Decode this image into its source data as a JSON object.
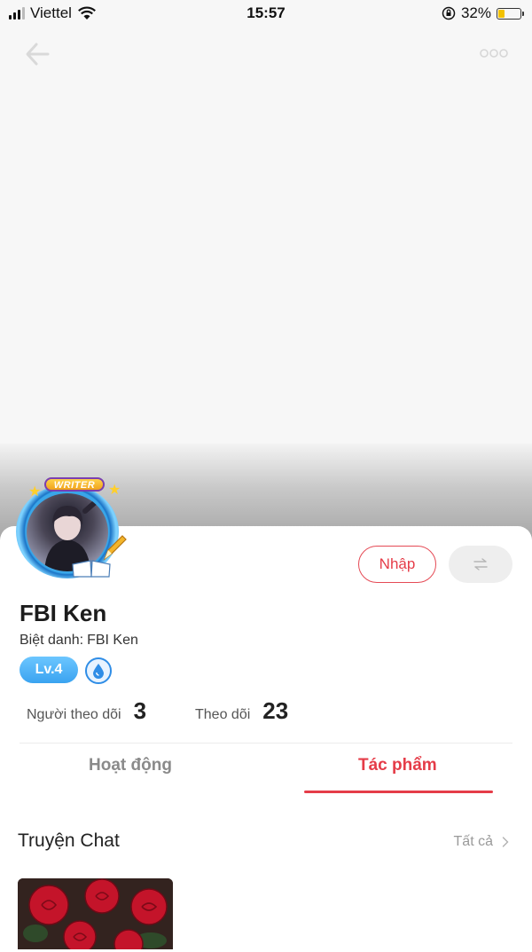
{
  "status_bar": {
    "carrier": "Viettel",
    "time": "15:57",
    "battery": "32%",
    "battery_fraction": 0.32,
    "battery_color": "#f3c200"
  },
  "nav": {
    "back_icon": "arrow-left-icon",
    "more_icon": "more-dots-icon"
  },
  "profile": {
    "avatar_badge": "WRITER",
    "name": "FBI Ken",
    "nickname_label": "Biệt danh:",
    "nickname": "FBI Ken",
    "level": "Lv.4",
    "badge_icon": "water-drop-icon"
  },
  "actions": {
    "import_label": "Nhập",
    "swap_icon": "swap-arrows-icon"
  },
  "stats": {
    "followers_label": "Người theo dõi",
    "followers_value": "3",
    "following_label": "Theo dõi",
    "following_value": "23"
  },
  "tabs": [
    {
      "label": "Hoạt động",
      "active": false
    },
    {
      "label": "Tác phẩm",
      "active": true
    }
  ],
  "section": {
    "title": "Truyện Chat",
    "see_all": "Tất cả"
  },
  "colors": {
    "accent": "#e53c48",
    "level_badge": "#3aa3f0"
  }
}
